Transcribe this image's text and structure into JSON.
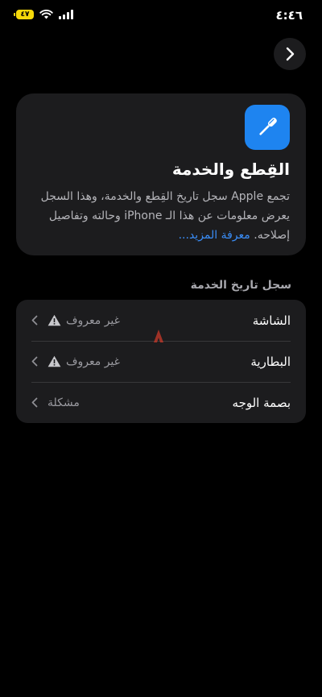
{
  "status_bar": {
    "time": "٤:٤٦",
    "battery_level": "٤٧",
    "battery_color": "#f5d90a"
  },
  "nav": {
    "back_icon": "chevron-right-icon"
  },
  "info_card": {
    "icon": "screwdriver-icon",
    "icon_bg": "#1e84f0",
    "title": "القِطع والخدمة",
    "description": "تجمع Apple سجل تاريخ القِطع والخدمة، وهذا السجل يعرض معلومات عن هذا الـ iPhone وحالته وتفاصيل إصلاحه.",
    "learn_more": "معرفة المزيد..."
  },
  "service_history": {
    "header": "سجل تاريخ الخدمة",
    "items": [
      {
        "label": "الشاشة",
        "status": "غير معروف",
        "warning": true
      },
      {
        "label": "البطارية",
        "status": "غير معروف",
        "warning": true
      },
      {
        "label": "بصمة الوجه",
        "status": "مشكلة",
        "warning": false
      }
    ]
  }
}
